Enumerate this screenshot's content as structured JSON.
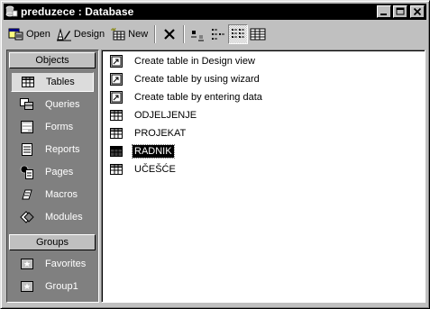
{
  "window": {
    "title": "preduzece : Database"
  },
  "toolbar": {
    "open_label": "Open",
    "design_label": "Design",
    "new_label": "New",
    "icons": [
      "delete-icon",
      "large-icons-view-icon",
      "small-icons-view-icon",
      "list-view-icon",
      "details-view-icon"
    ]
  },
  "objects_bar": {
    "objects_header": "Objects",
    "items": [
      {
        "label": "Tables",
        "icon": "table-icon",
        "selected": true
      },
      {
        "label": "Queries",
        "icon": "query-icon"
      },
      {
        "label": "Forms",
        "icon": "form-icon"
      },
      {
        "label": "Reports",
        "icon": "report-icon"
      },
      {
        "label": "Pages",
        "icon": "page-icon"
      },
      {
        "label": "Macros",
        "icon": "macro-icon"
      },
      {
        "label": "Modules",
        "icon": "module-icon"
      }
    ],
    "groups_header": "Groups",
    "groups": [
      {
        "label": "Favorites",
        "icon": "favorites-icon"
      },
      {
        "label": "Group1",
        "icon": "group-icon"
      }
    ]
  },
  "list": {
    "items": [
      {
        "label": "Create table in Design view",
        "icon": "shortcut-icon"
      },
      {
        "label": "Create table by using wizard",
        "icon": "shortcut-icon"
      },
      {
        "label": "Create table by entering data",
        "icon": "shortcut-icon"
      },
      {
        "label": "ODJELJENJE",
        "icon": "table-icon"
      },
      {
        "label": "PROJEKAT",
        "icon": "table-icon"
      },
      {
        "label": "RADNIK",
        "icon": "table-icon",
        "selected": true
      },
      {
        "label": "UČEŠĆE",
        "icon": "table-icon"
      }
    ]
  },
  "colors": {
    "title_bar": "#000000",
    "face": "#c0c0c0",
    "selection": "#000000"
  }
}
